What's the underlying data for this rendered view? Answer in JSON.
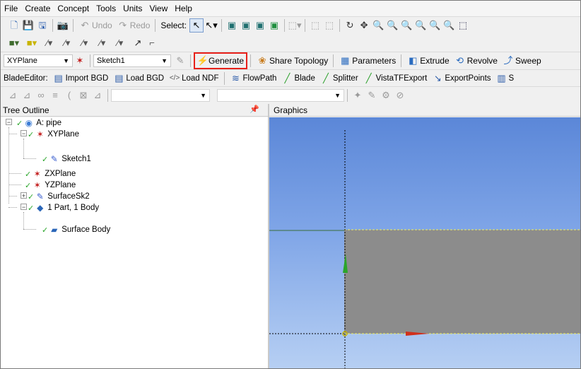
{
  "menu": [
    "File",
    "Create",
    "Concept",
    "Tools",
    "Units",
    "View",
    "Help"
  ],
  "toolbar1": {
    "undo": "Undo",
    "redo": "Redo",
    "select": "Select:"
  },
  "toolbar3": {
    "plane": "XYPlane",
    "sketch": "Sketch1",
    "generate": "Generate",
    "share_topology": "Share Topology",
    "parameters": "Parameters",
    "extrude": "Extrude",
    "revolve": "Revolve",
    "sweep": "Sweep"
  },
  "toolbar4": {
    "blade_editor": "BladeEditor:",
    "import_bgd": "Import BGD",
    "load_bgd": "Load BGD",
    "load_ndf": "Load NDF",
    "flowpath": "FlowPath",
    "blade": "Blade",
    "splitter": "Splitter",
    "vista_tf_export": "VistaTFExport",
    "export_points": "ExportPoints",
    "trailing": "S"
  },
  "panels": {
    "tree_title": "Tree Outline",
    "graphics_title": "Graphics"
  },
  "tree": {
    "root": "A: pipe",
    "xyplane": "XYPlane",
    "sketch1": "Sketch1",
    "zxplane": "ZXPlane",
    "yzplane": "YZPlane",
    "surfacesk2": "SurfaceSk2",
    "parts": "1 Part, 1 Body",
    "surface_body": "Surface Body"
  },
  "colors": {
    "highlight_border": "#e8211a",
    "body_gray": "#8c8c8c",
    "edge_yellow": "#f0f060",
    "check_green": "#2aa52a"
  }
}
